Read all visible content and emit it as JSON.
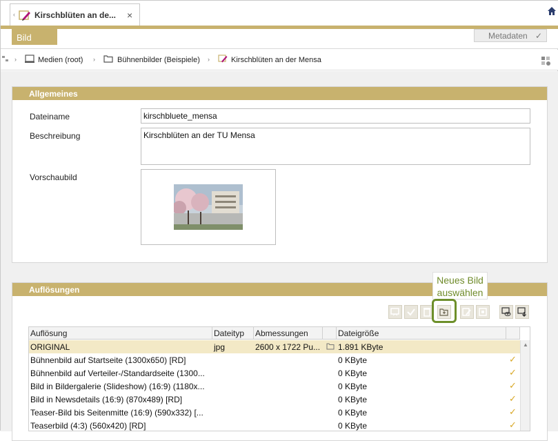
{
  "tab": {
    "title": "Kirschblüten an de...",
    "close": "×",
    "left_arrow": "‹",
    "icon": "image-edit-icon"
  },
  "subbar": {
    "bild_label": "Bild",
    "metadata_label": "Metadaten",
    "metadata_check": "✓"
  },
  "breadcrumb": {
    "items": [
      "Medien (root)",
      "Bühnenbilder (Beispiele)",
      "Kirschblüten an der Mensa"
    ],
    "sep": "›"
  },
  "general": {
    "title": "Allgemeines",
    "filename_label": "Dateiname",
    "filename_value": "kirschbluete_mensa",
    "description_label": "Beschreibung",
    "description_value": "Kirschblüten an der TU Mensa",
    "preview_label": "Vorschaubild"
  },
  "resolutions": {
    "title": "Auflösungen",
    "tooltip_line1": "Neues Bild",
    "tooltip_line2": "auswählen",
    "columns": [
      "Auflösung",
      "Dateityp",
      "Abmessungen",
      "",
      "Dateigröße"
    ],
    "rows": [
      {
        "name": "ORIGINAL",
        "type": "jpg",
        "dims": "2600 x 1722 Pu...",
        "size": "1.891 KByte",
        "check": ""
      },
      {
        "name": "Bühnenbild auf Startseite (1300x650) [RD]",
        "type": "",
        "dims": "",
        "size": "0 KByte",
        "check": "✓"
      },
      {
        "name": "Bühnenbild auf Verteiler-/Standardseite (1300...",
        "type": "",
        "dims": "",
        "size": "0 KByte",
        "check": "✓"
      },
      {
        "name": "Bild in Bildergalerie (Slideshow) (16:9) (1180x...",
        "type": "",
        "dims": "",
        "size": "0 KByte",
        "check": "✓"
      },
      {
        "name": "Bild in Newsdetails (16:9) (870x489) [RD]",
        "type": "",
        "dims": "",
        "size": "0 KByte",
        "check": "✓"
      },
      {
        "name": "Teaser-Bild bis Seitenmitte (16:9) (590x332) [...",
        "type": "",
        "dims": "",
        "size": "0 KByte",
        "check": "✓"
      },
      {
        "name": "Teaserbild (4:3) (560x420) [RD]",
        "type": "",
        "dims": "",
        "size": "0 KByte",
        "check": "✓"
      }
    ]
  },
  "colors": {
    "accent": "#c8b26e",
    "tooltip": "#6f8b2a",
    "selected_row": "#f3e9c6",
    "check": "#d8a826"
  }
}
